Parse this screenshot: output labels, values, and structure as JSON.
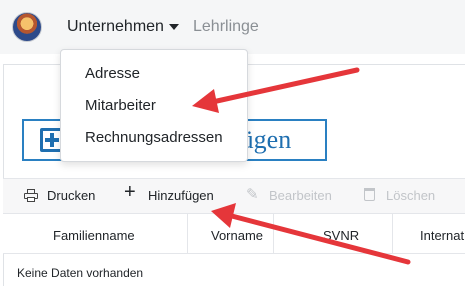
{
  "navbar": {
    "company_label": "Unternehmen",
    "apprentices_label": "Lehrlinge"
  },
  "dropdown": {
    "items": [
      {
        "label": "Adresse"
      },
      {
        "label": "Mitarbeiter"
      },
      {
        "label": "Rechnungsadressen"
      }
    ]
  },
  "big_button": {
    "label_visible": "fügen"
  },
  "toolbar": {
    "print_label": "Drucken",
    "add_label": "Hinzufügen",
    "edit_label": "Bearbeiten",
    "delete_label": "Löschen"
  },
  "grid": {
    "columns": [
      "Familienname",
      "Vorname",
      "SVNR",
      "Internat"
    ],
    "empty_text": "Keine Daten vorhanden"
  },
  "colors": {
    "accent_blue": "#1f6fb0",
    "annotation_arrow": "#e5363a",
    "disabled_text": "#c2c5c9"
  },
  "icons": {
    "print": "printer-icon",
    "add": "plus-icon",
    "edit": "pencil-icon",
    "delete": "trash-icon",
    "caret": "caret-down-icon"
  }
}
